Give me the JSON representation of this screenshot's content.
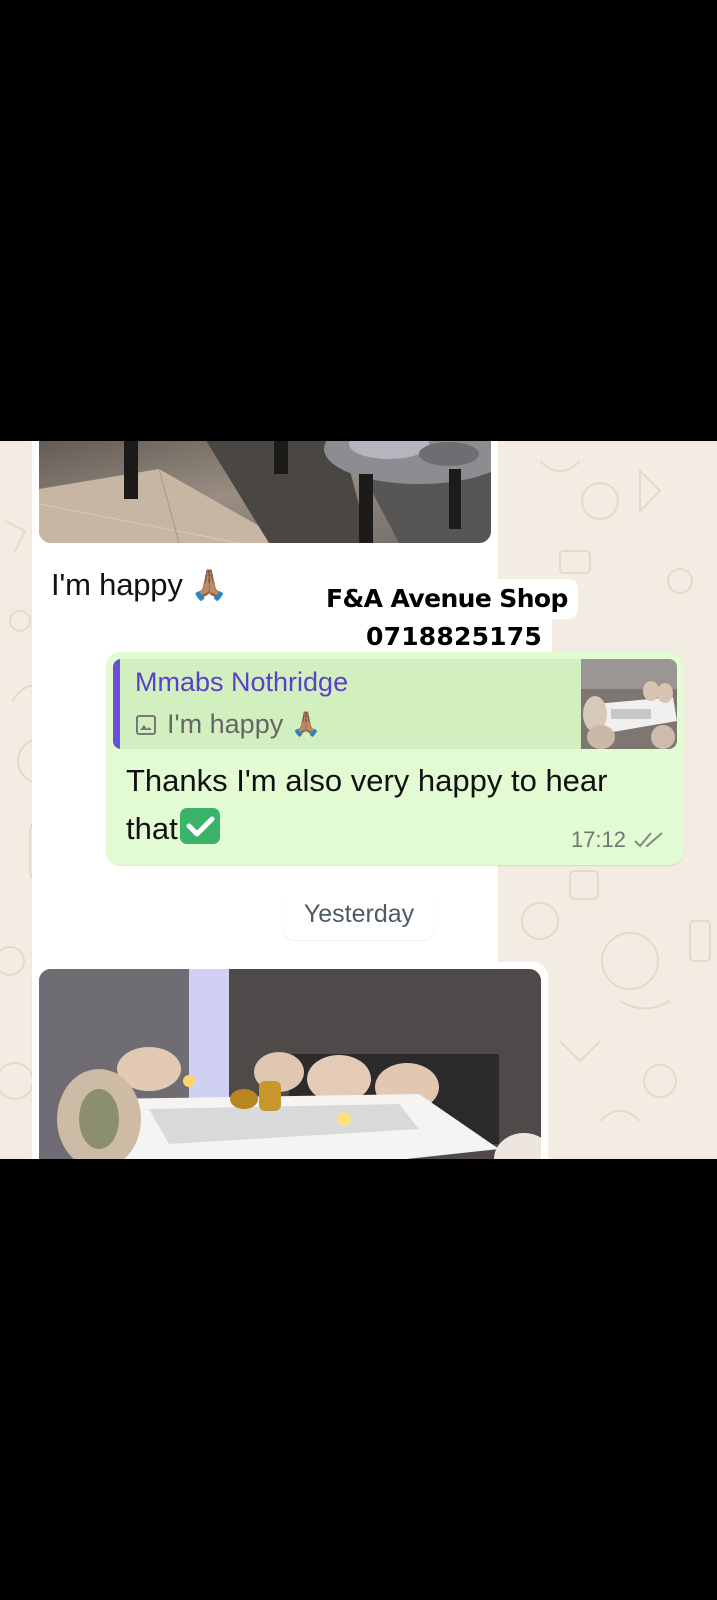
{
  "watermark": {
    "shop_name": "F&A Avenue Shop",
    "phone": "0718825175"
  },
  "messages": {
    "incoming_1": {
      "caption": "I'm happy",
      "emoji": "🙏🏽",
      "photo_icon": "photo-chairs-floor"
    },
    "outgoing_1": {
      "quoted_author": "Mmabs Nothridge",
      "quoted_text": "I'm happy",
      "quoted_emoji": "🙏🏽",
      "quoted_icon": "image-icon",
      "text": "Thanks  I'm also very happy to hear that",
      "check_emoji_icon": "check-mark-button-icon",
      "time": "17:12",
      "status_icon": "double-tick-icon"
    },
    "date_separator": "Yesterday",
    "incoming_2": {
      "photo_icon": "photo-dining-room"
    }
  },
  "colors": {
    "chat_background": "#f3ece2",
    "outgoing_bubble": "#e2fbd3",
    "quote_bar": "#6b4fd6",
    "quote_author": "#5b41c8",
    "incoming_bubble": "#ffffff"
  }
}
